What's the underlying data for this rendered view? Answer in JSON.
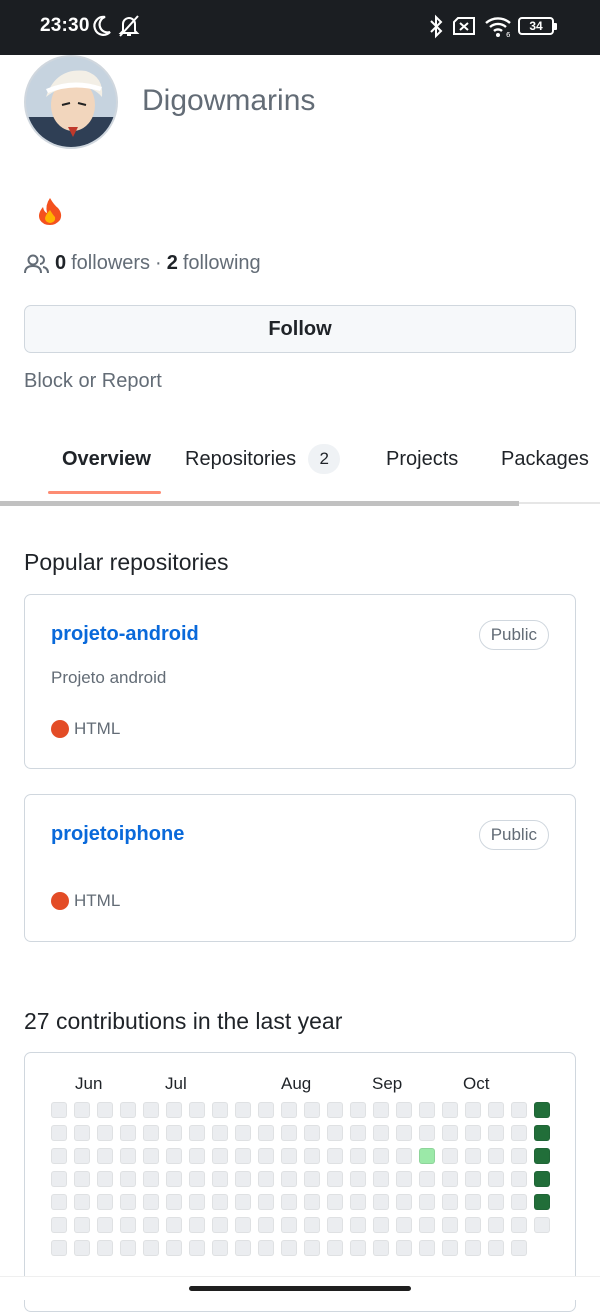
{
  "status_bar": {
    "time": "23:30",
    "icons": [
      "moon-icon",
      "bell-off-icon",
      "bluetooth-icon",
      "no-sim-icon",
      "wifi-icon",
      "battery-icon"
    ],
    "battery": "34"
  },
  "profile": {
    "username": "Digowmarins",
    "status_emoji": "fire-icon",
    "followers_count": "0",
    "followers_label": "followers",
    "separator": "·",
    "following_count": "2",
    "following_label": "following",
    "follow_button": "Follow",
    "block_report": "Block or Report"
  },
  "tabs": [
    {
      "label": "Overview",
      "active": true
    },
    {
      "label": "Repositories",
      "count": "2"
    },
    {
      "label": "Projects"
    },
    {
      "label": "Packages"
    }
  ],
  "popular": {
    "title": "Popular repositories",
    "repos": [
      {
        "name": "projeto-android",
        "visibility": "Public",
        "description": "Projeto android",
        "language": "HTML",
        "language_color": "#e34c26"
      },
      {
        "name": "projetoiphone",
        "visibility": "Public",
        "description": "",
        "language": "HTML",
        "language_color": "#e34c26"
      }
    ]
  },
  "contributions": {
    "title": "27 contributions in the last year",
    "months": [
      "Jun",
      "Jul",
      "Aug",
      "Sep",
      "Oct"
    ],
    "colors": {
      "empty": "#ebedf0",
      "level1": "#9be9a8",
      "level4": "#216e39"
    },
    "active_cells": [
      {
        "week": 16,
        "day": 2,
        "level": 1
      },
      {
        "week": 21,
        "day": 0,
        "level": 4
      },
      {
        "week": 21,
        "day": 1,
        "level": 4
      },
      {
        "week": 21,
        "day": 2,
        "level": 4
      },
      {
        "week": 21,
        "day": 3,
        "level": 4
      },
      {
        "week": 21,
        "day": 4,
        "level": 4
      }
    ]
  }
}
